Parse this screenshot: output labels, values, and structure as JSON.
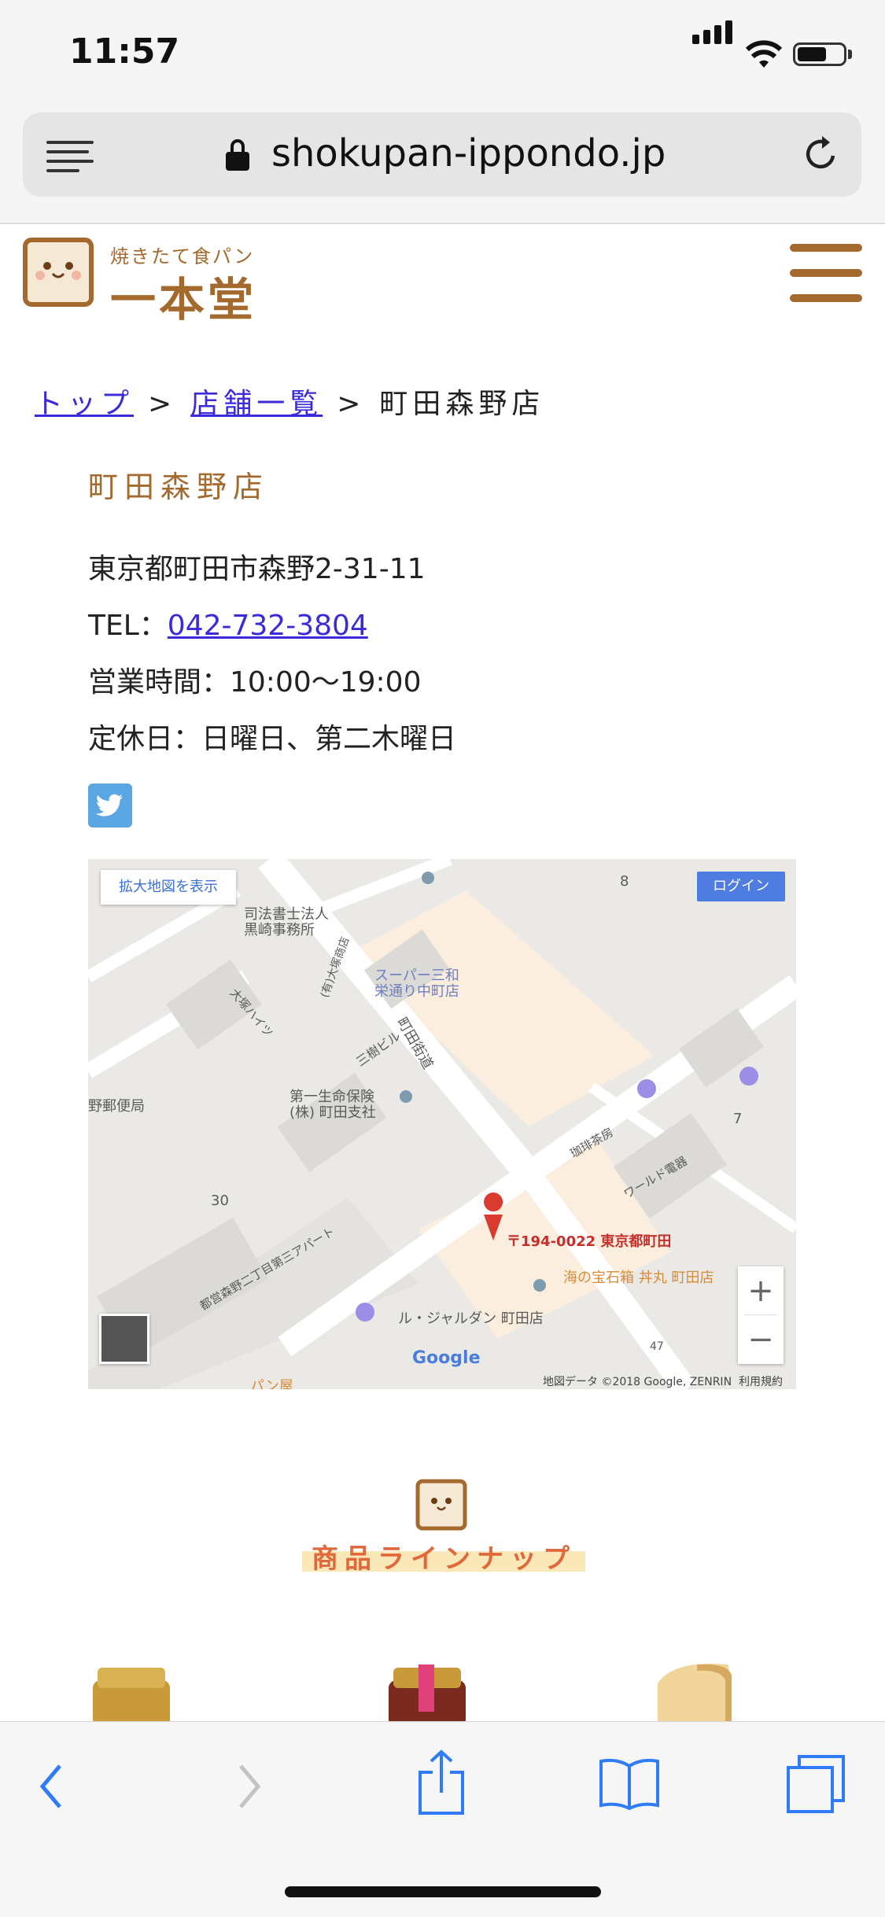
{
  "status_bar": {
    "time": "11:57"
  },
  "browser": {
    "url": "shokupan-ippondo.jp"
  },
  "site": {
    "logo_small": "焼きたて食パン",
    "logo_big": "一本堂"
  },
  "breadcrumb": {
    "items": [
      "トップ",
      "店舗一覧",
      "町田森野店"
    ],
    "separator": ">"
  },
  "shop": {
    "title": "町田森野店",
    "address": "東京都町田市森野2-31-11",
    "tel_label": "TEL：",
    "tel": "042-732-3804",
    "hours": "営業時間：10:00〜19:00",
    "closed": "定休日：日曜日、第二木曜日"
  },
  "map": {
    "enlarge_label": "拡大地図を表示",
    "login_label": "ログイン",
    "labels": [
      "司法書士法人",
      "黒崎事務所",
      "スーパー三和",
      "栄通り中町店",
      "町田街道",
      "第一生命保険",
      "(株) 町田支社",
      "野郵便局",
      "三樹ビル",
      "大塚ハイツ",
      "(有)大塚商店",
      "珈琲茶房",
      "ワールド電器",
      "都営森野二丁目第三アパート",
      "〒194-0022 東京都町田",
      "海の宝石箱 丼丸 町田店",
      "ル・ジャルダン 町田店",
      "パン屋",
      "8",
      "7",
      "30",
      "47"
    ],
    "google": "Google",
    "credit": "地図データ ©2018 Google, ZENRIN",
    "terms": "利用規約",
    "zoom_in": "+",
    "zoom_out": "−"
  },
  "lineup": {
    "title": "商品ラインナップ"
  }
}
